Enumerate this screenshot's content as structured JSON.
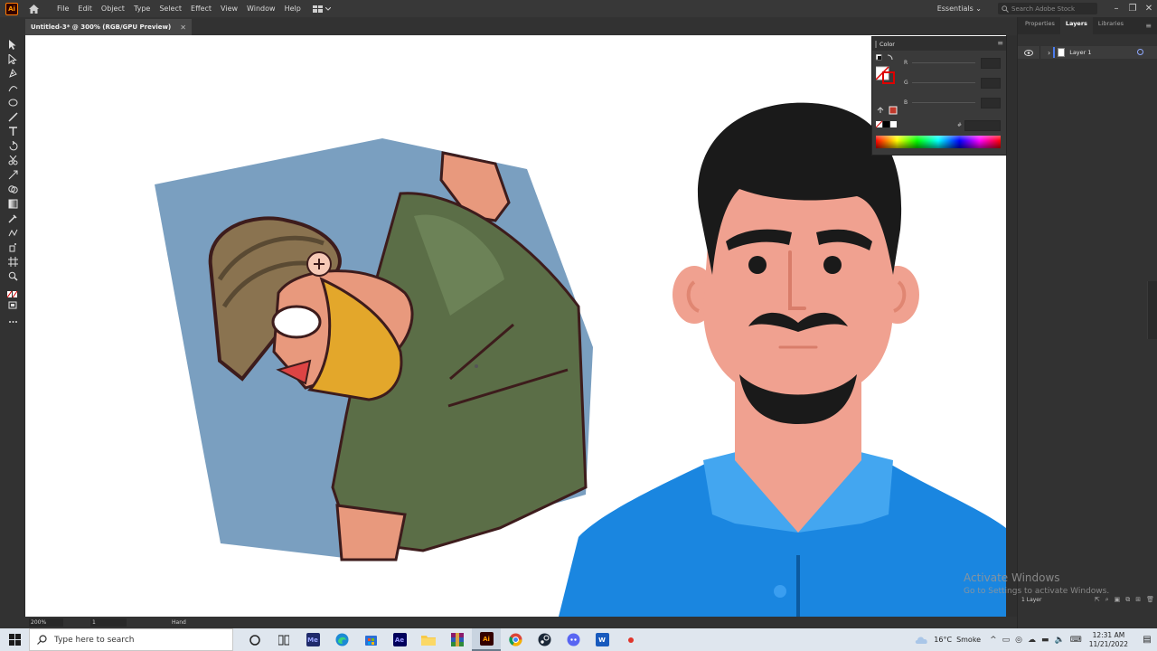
{
  "app": {
    "logo": "Ai",
    "menus": [
      "File",
      "Edit",
      "Object",
      "Type",
      "Select",
      "Effect",
      "View",
      "Window",
      "Help"
    ],
    "workspace": "Essentials",
    "search_placeholder": "Search Adobe Stock"
  },
  "document_tab": {
    "title": "Untitled-3* @ 300% (RGB/GPU Preview)"
  },
  "color_panel": {
    "title": "Color",
    "channels": [
      "R",
      "G",
      "B"
    ],
    "hex_prefix": "#"
  },
  "right_panel": {
    "tabs": [
      "Properties",
      "Layers",
      "Libraries"
    ],
    "active_tab": "Layers",
    "layers": [
      {
        "name": "Layer 1"
      }
    ],
    "footer_count": "1 Layer"
  },
  "statusbar": {
    "zoom": "200%",
    "page": "1",
    "tool": "Hand"
  },
  "watermark": {
    "line1": "Activate Windows",
    "line2": "Go to Settings to activate Windows."
  },
  "taskbar": {
    "search_placeholder": "Type here to search",
    "apps": [
      {
        "icon": "task-view-icon"
      },
      {
        "icon": "widgets-icon"
      },
      {
        "label": "Me",
        "color": "#1f2a6b"
      },
      {
        "icon": "edge-icon"
      },
      {
        "icon": "store-icon"
      },
      {
        "label": "Ae",
        "color": "#00005b"
      },
      {
        "icon": "file-explorer-icon"
      },
      {
        "icon": "winrar-icon"
      },
      {
        "label": "Ai",
        "color": "#330000",
        "active": true
      },
      {
        "icon": "chrome-icon"
      },
      {
        "icon": "steam-icon"
      },
      {
        "icon": "discord-icon"
      },
      {
        "label": "W",
        "color": "#185abd"
      },
      {
        "icon": "record-icon"
      }
    ],
    "weather": {
      "temp": "16°C",
      "condition": "Smoke"
    },
    "time": "12:31 AM",
    "date": "11/21/2022"
  },
  "colors": {
    "accent": "#4b7bec",
    "illustrator_orange": "#ff9a00",
    "shirt_blue": "#1a86e0",
    "skin": "#f0a190"
  }
}
